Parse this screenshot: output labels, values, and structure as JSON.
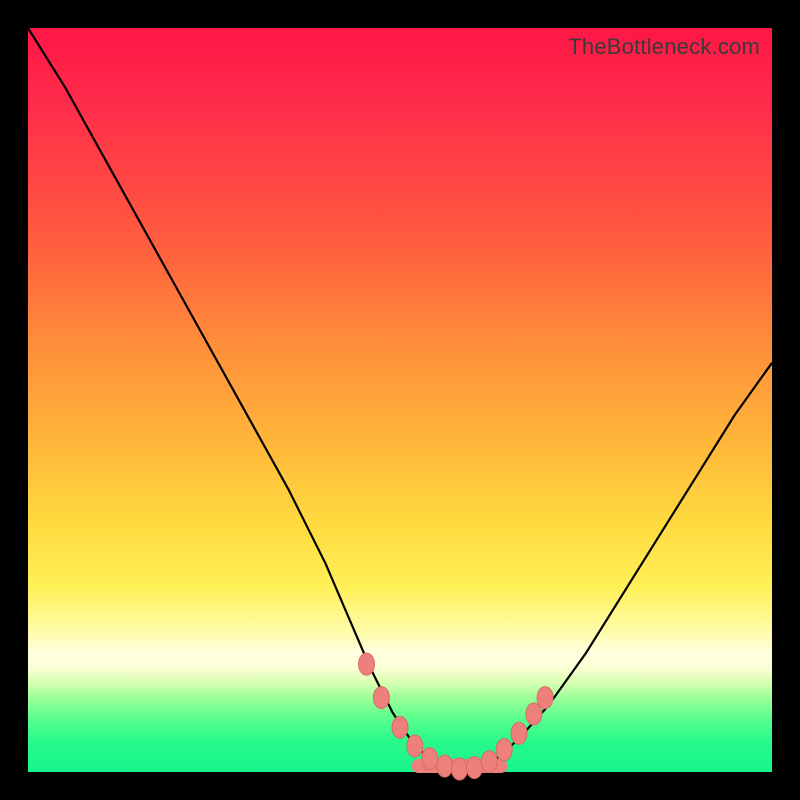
{
  "watermark": {
    "text": "TheBottleneck.com"
  },
  "colors": {
    "frame": "#000000",
    "curve": "#000000",
    "marker_fill": "#ee807b",
    "marker_stroke": "#d96a65",
    "gradient_stops": [
      "#ff1646",
      "#ff2b4a",
      "#ff5a3f",
      "#ff8c3a",
      "#ffb43a",
      "#ffd83e",
      "#fff056",
      "#fffca8",
      "#ffffe0",
      "#fbffd4",
      "#d7ffb0",
      "#9dff9a",
      "#56ff8e",
      "#27f98c",
      "#17f58c"
    ]
  },
  "chart_data": {
    "type": "line",
    "title": "",
    "xlabel": "",
    "ylabel": "",
    "xlim": [
      0,
      100
    ],
    "ylim": [
      0,
      100
    ],
    "grid": false,
    "legend": false,
    "series": [
      {
        "name": "bottleneck-curve",
        "x": [
          0,
          5,
          10,
          15,
          20,
          25,
          30,
          35,
          40,
          43,
          46,
          49,
          52,
          55,
          58,
          60,
          63,
          66,
          70,
          75,
          80,
          85,
          90,
          95,
          100
        ],
        "y": [
          100,
          92,
          83,
          74,
          65,
          56,
          47,
          38,
          28,
          21,
          14,
          8,
          3.5,
          1,
          0.3,
          0.5,
          1.8,
          4.5,
          9,
          16,
          24,
          32,
          40,
          48,
          55
        ]
      }
    ],
    "markers": [
      {
        "x": 45.5,
        "y": 14.5
      },
      {
        "x": 47.5,
        "y": 10.0
      },
      {
        "x": 50.0,
        "y": 6.0
      },
      {
        "x": 52.0,
        "y": 3.5
      },
      {
        "x": 54.0,
        "y": 1.8
      },
      {
        "x": 56.0,
        "y": 0.8
      },
      {
        "x": 58.0,
        "y": 0.4
      },
      {
        "x": 60.0,
        "y": 0.6
      },
      {
        "x": 62.0,
        "y": 1.4
      },
      {
        "x": 64.0,
        "y": 3.0
      },
      {
        "x": 66.0,
        "y": 5.2
      },
      {
        "x": 68.0,
        "y": 7.8
      },
      {
        "x": 69.5,
        "y": 10.0
      }
    ],
    "flat_segment": {
      "x_start": 52.5,
      "x_end": 63.5,
      "y": 0.8
    }
  }
}
